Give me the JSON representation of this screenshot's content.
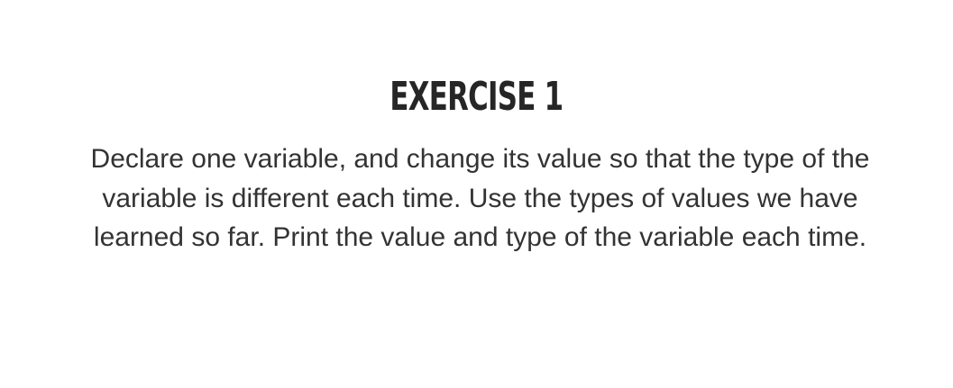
{
  "exercise": {
    "title": "EXERCISE 1",
    "instructions": "Declare one variable, and change its value so that the type of the variable is different each time. Use the types of values we have learned so far. Print the value and type of the variable each time."
  }
}
